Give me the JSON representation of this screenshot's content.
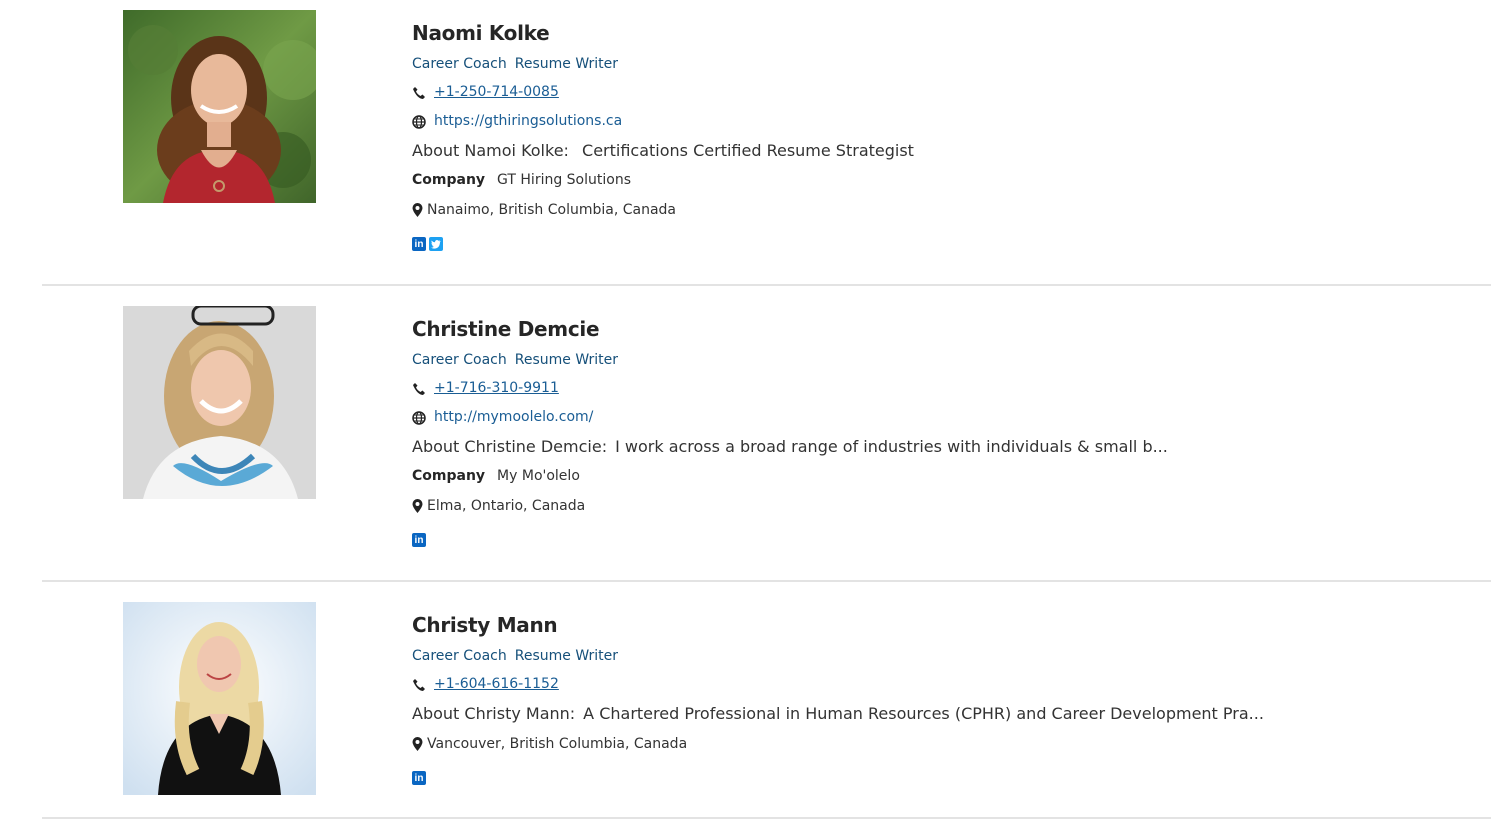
{
  "profiles": [
    {
      "name": "Naomi Kolke",
      "categories": [
        "Career Coach",
        "Resume Writer"
      ],
      "phone": "+1-250-714-0085",
      "website": "https://gthiringsolutions.ca",
      "about_label": "About Namoi Kolke:",
      "about_text": "Certifications Certified Resume Strategist",
      "company_label": "Company",
      "company": "GT Hiring Solutions",
      "location": "Nanaimo, British Columbia, Canada",
      "social": [
        "linkedin-icon",
        "twitter-icon"
      ]
    },
    {
      "name": "Christine Demcie",
      "categories": [
        "Career Coach",
        "Resume Writer"
      ],
      "phone": "+1-716-310-9911",
      "website": "http://mymoolelo.com/",
      "about_label": "About Christine Demcie:",
      "about_text": "I work across a broad range of industries with individuals & small b...",
      "company_label": "Company",
      "company": "My Mo'olelo",
      "location": "Elma, Ontario, Canada",
      "social": [
        "linkedin-icon"
      ]
    },
    {
      "name": "Christy Mann",
      "categories": [
        "Career Coach",
        "Resume Writer"
      ],
      "phone": "+1-604-616-1152",
      "about_label": "About Christy Mann:",
      "about_text": "A Chartered Professional in Human Resources (CPHR) and Career Development Pra...",
      "location": "Vancouver, British Columbia, Canada",
      "social": [
        "linkedin-icon"
      ]
    }
  ],
  "icons": {
    "phone": "phone-icon",
    "website": "globe-icon",
    "location": "map-marker-icon"
  },
  "colors": {
    "link": "#1a5d94",
    "category": "#16507a",
    "linkedin": "#0a66c2",
    "twitter": "#1da1f2",
    "divider": "#e3e3e3"
  }
}
